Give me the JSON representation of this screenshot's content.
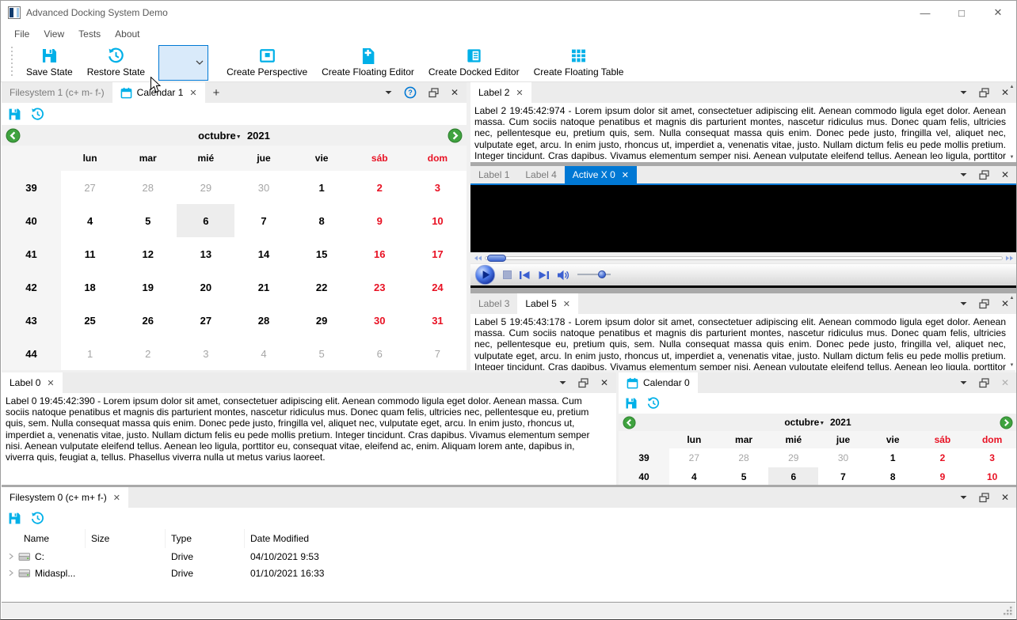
{
  "colors": {
    "accent": "#00b0e8",
    "focus": "#0078d4",
    "red": "#e81123",
    "green": "#3fa33f"
  },
  "window": {
    "title": "Advanced Docking System Demo",
    "minimize_icon": "—",
    "maximize_icon": "□",
    "close_icon": "✕"
  },
  "menu": {
    "items": [
      "File",
      "View",
      "Tests",
      "About"
    ]
  },
  "toolbar": {
    "save_state": "Save State",
    "restore_state": "Restore State",
    "perspective_combo_value": "",
    "create_perspective": "Create Perspective",
    "create_floating_editor": "Create Floating Editor",
    "create_docked_editor": "Create Docked Editor",
    "create_floating_table": "Create Floating Table"
  },
  "dock_top_left": {
    "tabs": [
      "Filesystem 1 (c+ m- f-)",
      "Calendar 1"
    ],
    "add_tab": "+"
  },
  "calendar": {
    "month": "octubre",
    "year": "2021",
    "weekdays": [
      {
        "t": "lun"
      },
      {
        "t": "mar"
      },
      {
        "t": "mié"
      },
      {
        "t": "jue"
      },
      {
        "t": "vie"
      },
      {
        "t": "sáb",
        "cls": "red"
      },
      {
        "t": "dom",
        "cls": "red"
      }
    ],
    "cells": [
      {
        "t": "39",
        "cls": "wk"
      },
      {
        "t": "27",
        "cls": "dim"
      },
      {
        "t": "28",
        "cls": "dim"
      },
      {
        "t": "29",
        "cls": "dim"
      },
      {
        "t": "30",
        "cls": "dim"
      },
      {
        "t": "1"
      },
      {
        "t": "2",
        "cls": "red"
      },
      {
        "t": "3",
        "cls": "red"
      },
      {
        "t": "40",
        "cls": "wk"
      },
      {
        "t": "4"
      },
      {
        "t": "5"
      },
      {
        "t": "6",
        "cls": "sel"
      },
      {
        "t": "7"
      },
      {
        "t": "8"
      },
      {
        "t": "9",
        "cls": "red"
      },
      {
        "t": "10",
        "cls": "red"
      },
      {
        "t": "41",
        "cls": "wk"
      },
      {
        "t": "11"
      },
      {
        "t": "12"
      },
      {
        "t": "13"
      },
      {
        "t": "14"
      },
      {
        "t": "15"
      },
      {
        "t": "16",
        "cls": "red"
      },
      {
        "t": "17",
        "cls": "red"
      },
      {
        "t": "42",
        "cls": "wk"
      },
      {
        "t": "18"
      },
      {
        "t": "19"
      },
      {
        "t": "20"
      },
      {
        "t": "21"
      },
      {
        "t": "22"
      },
      {
        "t": "23",
        "cls": "red"
      },
      {
        "t": "24",
        "cls": "red"
      },
      {
        "t": "43",
        "cls": "wk"
      },
      {
        "t": "25"
      },
      {
        "t": "26"
      },
      {
        "t": "27"
      },
      {
        "t": "28"
      },
      {
        "t": "29"
      },
      {
        "t": "30",
        "cls": "red"
      },
      {
        "t": "31",
        "cls": "red"
      },
      {
        "t": "44",
        "cls": "wk"
      },
      {
        "t": "1",
        "cls": "dim"
      },
      {
        "t": "2",
        "cls": "dim"
      },
      {
        "t": "3",
        "cls": "dim"
      },
      {
        "t": "4",
        "cls": "dim"
      },
      {
        "t": "5",
        "cls": "dim"
      },
      {
        "t": "6",
        "cls": "dim"
      },
      {
        "t": "7",
        "cls": "dim"
      }
    ]
  },
  "label2": {
    "tab": "Label 2",
    "text": "Label 2 19:45:42:974 - Lorem ipsum dolor sit amet, consectetuer adipiscing elit. Aenean commodo ligula eget dolor. Aenean massa. Cum sociis natoque penatibus et magnis dis parturient montes, nascetur ridiculus mus. Donec quam felis, ultricies nec, pellentesque eu, pretium quis, sem. Nulla consequat massa quis enim. Donec pede justo, fringilla vel, aliquet nec, vulputate eget, arcu. In enim justo, rhoncus ut, imperdiet a, venenatis vitae, justo. Nullam dictum felis eu pede mollis pretium. Integer tincidunt. Cras dapibus. Vivamus elementum semper nisi. Aenean vulputate eleifend tellus. Aenean leo ligula, porttitor eu, consequat vitae, eleifend ac, enim. Aliquam"
  },
  "media": {
    "tabs": [
      "Label 1",
      "Label 4",
      "Active X 0"
    ]
  },
  "label5": {
    "tabs": [
      "Label 3",
      "Label 5"
    ],
    "text": "Label 5 19:45:43:178 - Lorem ipsum dolor sit amet, consectetuer adipiscing elit. Aenean commodo ligula eget dolor. Aenean massa. Cum sociis natoque penatibus et magnis dis parturient montes, nascetur ridiculus mus. Donec quam felis, ultricies nec, pellentesque eu, pretium quis, sem. Nulla consequat massa quis enim. Donec pede justo, fringilla vel, aliquet nec, vulputate eget, arcu. In enim justo, rhoncus ut, imperdiet a, venenatis vitae, justo. Nullam dictum felis eu pede mollis pretium. Integer tincidunt. Cras dapibus. Vivamus elementum semper nisi. Aenean vulputate eleifend tellus. Aenean leo ligula, porttitor eu, consequat vitae, eleifend ac, enim. Aliquam"
  },
  "label0": {
    "tab": "Label 0",
    "text": "Label 0 19:45:42:390 - Lorem ipsum dolor sit amet, consectetuer adipiscing elit. Aenean commodo ligula eget dolor. Aenean massa. Cum sociis natoque penatibus et magnis dis parturient montes, nascetur ridiculus mus. Donec quam felis, ultricies nec, pellentesque eu, pretium quis, sem. Nulla consequat massa quis enim. Donec pede justo, fringilla vel, aliquet nec, vulputate eget, arcu. In enim justo, rhoncus ut, imperdiet a, venenatis vitae, justo. Nullam dictum felis eu pede mollis pretium. Integer tincidunt. Cras dapibus. Vivamus elementum semper nisi. Aenean vulputate eleifend tellus. Aenean leo ligula, porttitor eu, consequat vitae, eleifend ac, enim. Aliquam lorem ante, dapibus in, viverra quis, feugiat a, tellus. Phasellus viverra nulla ut metus varius laoreet."
  },
  "calendar0": {
    "tab": "Calendar 0"
  },
  "filesystem0": {
    "tab": "Filesystem 0 (c+ m+ f-)",
    "columns": [
      "Name",
      "Size",
      "Type",
      "Date Modified"
    ],
    "rows": [
      {
        "name": "C:",
        "size": "",
        "type": "Drive",
        "modified": "04/10/2021 9:53"
      },
      {
        "name": "Midaspl...",
        "size": "",
        "type": "Drive",
        "modified": "01/10/2021 16:33"
      }
    ]
  }
}
